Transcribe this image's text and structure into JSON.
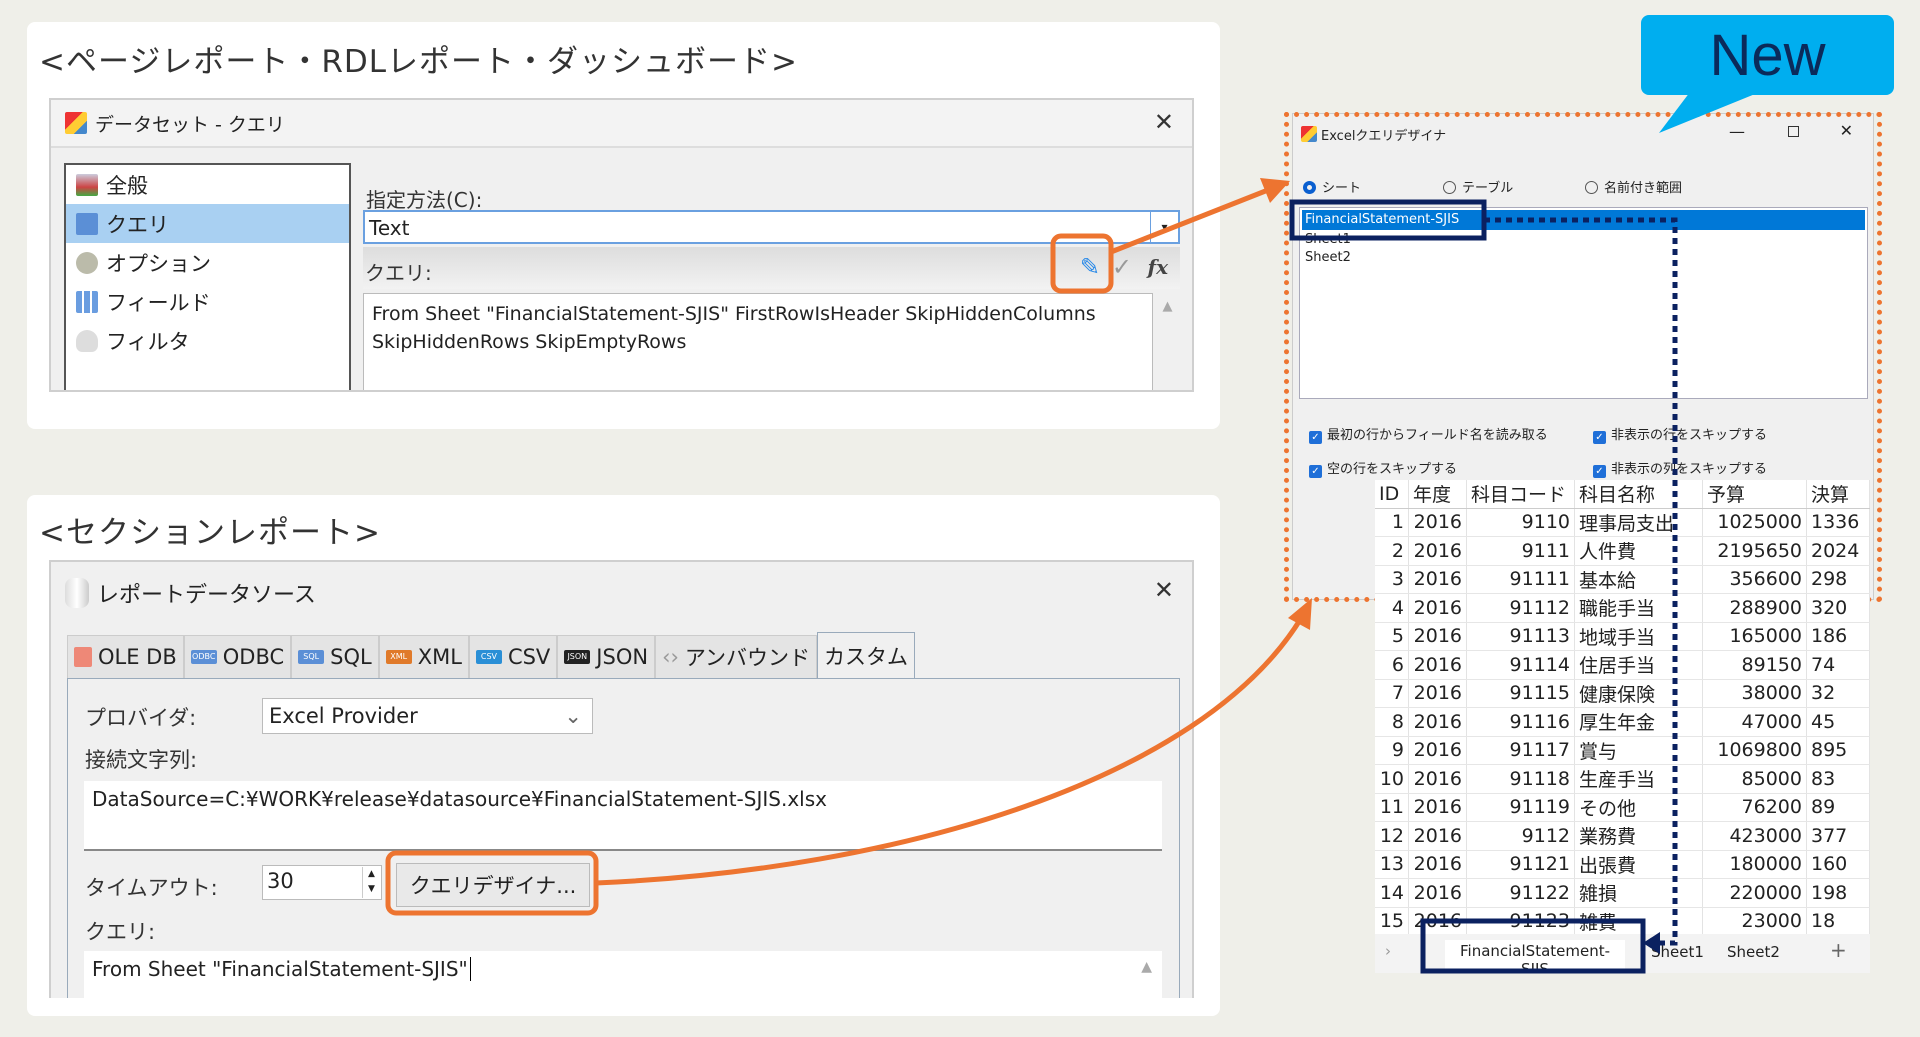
{
  "top_section": {
    "heading": "<ページレポート・RDLレポート・ダッシュボード>",
    "dialog": {
      "title": "データセット - クエリ",
      "nav": [
        {
          "label": "全般",
          "icon": "general-icon"
        },
        {
          "label": "クエリ",
          "icon": "query-icon",
          "selected": true
        },
        {
          "label": "オプション",
          "icon": "options-icon"
        },
        {
          "label": "フィールド",
          "icon": "fields-icon"
        },
        {
          "label": "フィルタ",
          "icon": "filter-icon"
        }
      ],
      "method_label": "指定方法(C):",
      "method_value": "Text",
      "query_label": "クエリ:",
      "query_text": "From Sheet \"FinancialStatement-SJIS\" FirstRowIsHeader SkipHiddenColumns SkipHiddenRows SkipEmptyRows",
      "fx_label": "fx"
    }
  },
  "bottom_section": {
    "heading": "<セクションレポート>",
    "dialog": {
      "title": "レポートデータソース",
      "tabs": [
        {
          "label": "OLE DB",
          "badge": ""
        },
        {
          "label": "ODBC",
          "badge": "ODBC",
          "color": "#5b8fd6"
        },
        {
          "label": "SQL",
          "badge": "SQL",
          "color": "#5b8fd6"
        },
        {
          "label": "XML",
          "badge": "XML",
          "color": "#e07a2a"
        },
        {
          "label": "CSV",
          "badge": "CSV",
          "color": "#2a8fd6"
        },
        {
          "label": "JSON",
          "badge": "JSON",
          "color": "#222222"
        },
        {
          "label": "アンバウンド",
          "badge": ""
        },
        {
          "label": "カスタム",
          "badge": "",
          "active": true
        }
      ],
      "provider_label": "プロバイダ:",
      "provider_value": "Excel Provider",
      "conn_label": "接続文字列:",
      "conn_value": "DataSource=C:¥WORK¥release¥datasource¥FinancialStatement-SJIS.xlsx",
      "timeout_label": "タイムアウト:",
      "timeout_value": "30",
      "designer_button": "クエリデザイナ...",
      "query_label": "クエリ:",
      "query_text": "From Sheet \"FinancialStatement-SJIS\""
    }
  },
  "callout": {
    "text": "New",
    "color": "#00aeef"
  },
  "excel_designer": {
    "title": "Excelクエリデザイナ",
    "radios": [
      {
        "label": "シート",
        "checked": true
      },
      {
        "label": "テーブル",
        "checked": false
      },
      {
        "label": "名前付き範囲",
        "checked": false
      }
    ],
    "sheets": [
      "FinancialStatement-SJIS",
      "Sheet1",
      "Sheet2"
    ],
    "selected_sheet": "FinancialStatement-SJIS",
    "options": [
      {
        "label": "最初の行からフィールド名を読み取る",
        "checked": true
      },
      {
        "label": "非表示の行をスキップする",
        "checked": true
      },
      {
        "label": "空の行をスキップする",
        "checked": true
      },
      {
        "label": "非表示の列をスキップする",
        "checked": true
      }
    ]
  },
  "sheet_preview": {
    "columns": [
      "ID",
      "年度",
      "科目コード",
      "科目名称",
      "予算",
      "決算"
    ],
    "rows": [
      [
        "1",
        "2016",
        "9110",
        "理事局支出",
        "1025000",
        "1336"
      ],
      [
        "2",
        "2016",
        "9111",
        "人件費",
        "2195650",
        "2024"
      ],
      [
        "3",
        "2016",
        "91111",
        "基本給",
        "356600",
        "298"
      ],
      [
        "4",
        "2016",
        "91112",
        "職能手当",
        "288900",
        "320"
      ],
      [
        "5",
        "2016",
        "91113",
        "地域手当",
        "165000",
        "186"
      ],
      [
        "6",
        "2016",
        "91114",
        "住居手当",
        "89150",
        "74"
      ],
      [
        "7",
        "2016",
        "91115",
        "健康保険",
        "38000",
        "32"
      ],
      [
        "8",
        "2016",
        "91116",
        "厚生年金",
        "47000",
        "45"
      ],
      [
        "9",
        "2016",
        "91117",
        "賞与",
        "1069800",
        "895"
      ],
      [
        "10",
        "2016",
        "91118",
        "生産手当",
        "85000",
        "83"
      ],
      [
        "11",
        "2016",
        "91119",
        "その他",
        "76200",
        "89"
      ],
      [
        "12",
        "2016",
        "9112",
        "業務費",
        "423000",
        "377"
      ],
      [
        "13",
        "2016",
        "91121",
        "出張費",
        "180000",
        "160"
      ],
      [
        "14",
        "2016",
        "91122",
        "雑損",
        "220000",
        "198"
      ],
      [
        "15",
        "2016",
        "91123",
        "雑費",
        "23000",
        "18"
      ]
    ],
    "sheet_tabs": [
      "FinancialStatement-SJIS",
      "Sheet1",
      "Sheet2"
    ],
    "active_tab": "FinancialStatement-SJIS",
    "add_sheet": "+"
  },
  "colors": {
    "highlight": "#ed7430",
    "navy": "#0b2160",
    "selection": "#0078d7"
  }
}
